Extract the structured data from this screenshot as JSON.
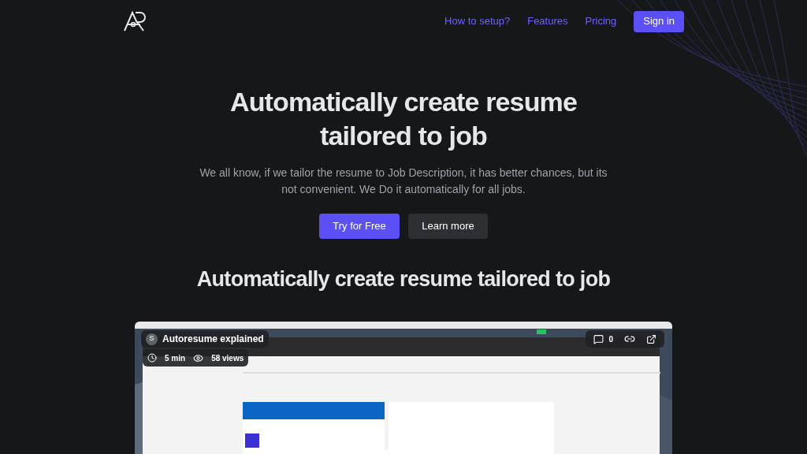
{
  "nav": {
    "links": [
      "How to setup?",
      "Features",
      "Pricing"
    ],
    "sign_in": "Sign in"
  },
  "hero": {
    "title": "Automatically create resume tailored to job",
    "subtitle": "We all know, if we tailor the resume to Job Description, it has better chances, but its not convenient. We Do it automatically for all jobs.",
    "primary": "Try for Free",
    "secondary": "Learn more"
  },
  "video_section": {
    "heading": "Automatically create resume tailored to job",
    "video": {
      "kind": "picture",
      "avatar": "S",
      "title": "Autoresume explained",
      "duration": "5 min",
      "views": "58 views",
      "comments": "0"
    }
  }
}
